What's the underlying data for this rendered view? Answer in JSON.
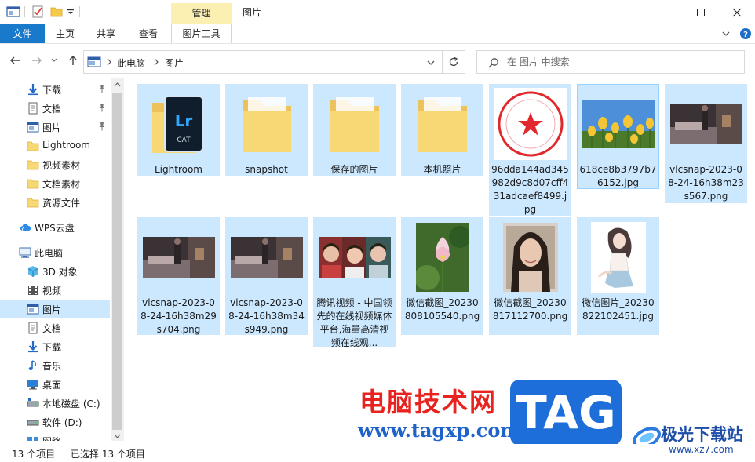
{
  "window": {
    "title": "图片",
    "context_tab": "管理"
  },
  "ribbon": {
    "file": "文件",
    "home": "主页",
    "share": "共享",
    "view": "查看",
    "picture_tools": "图片工具"
  },
  "address": {
    "crumb1": "此电脑",
    "crumb2": "图片"
  },
  "search": {
    "placeholder": "在 图片 中搜索"
  },
  "sidebar": {
    "items": [
      {
        "label": "下载",
        "icon": "download-arrow-icon",
        "pinned": true
      },
      {
        "label": "文档",
        "icon": "document-icon",
        "pinned": true
      },
      {
        "label": "图片",
        "icon": "pictures-icon",
        "pinned": true
      },
      {
        "label": "Lightroom",
        "icon": "folder-icon"
      },
      {
        "label": "视频素材",
        "icon": "folder-icon"
      },
      {
        "label": "文档素材",
        "icon": "folder-icon"
      },
      {
        "label": "资源文件",
        "icon": "folder-icon"
      },
      {
        "label": "WPS云盘",
        "icon": "cloud-icon"
      },
      {
        "label": "此电脑",
        "icon": "computer-icon"
      },
      {
        "label": "3D 对象",
        "icon": "3d-objects-icon"
      },
      {
        "label": "视频",
        "icon": "video-icon"
      },
      {
        "label": "图片",
        "icon": "pictures-icon",
        "selected": true
      },
      {
        "label": "文档",
        "icon": "document-icon"
      },
      {
        "label": "下载",
        "icon": "download-arrow-icon"
      },
      {
        "label": "音乐",
        "icon": "music-note-icon"
      },
      {
        "label": "桌面",
        "icon": "desktop-icon"
      },
      {
        "label": "本地磁盘 (C:)",
        "icon": "drive-c-icon"
      },
      {
        "label": "软件 (D:)",
        "icon": "drive-d-icon"
      },
      {
        "label": "网络",
        "icon": "network-icon"
      }
    ]
  },
  "files": [
    {
      "name": "Lightroom",
      "kind": "folder-lr"
    },
    {
      "name": "snapshot",
      "kind": "folder"
    },
    {
      "name": "保存的图片",
      "kind": "folder"
    },
    {
      "name": "本机照片",
      "kind": "folder"
    },
    {
      "name": "96dda144ad345982d9c8d07cff431adcaef8499.jpg",
      "kind": "seal"
    },
    {
      "name": "618ce8b3797b76152.jpg",
      "kind": "tulips"
    },
    {
      "name": "vlcsnap-2023-08-24-16h38m23s567.png",
      "kind": "bedroom"
    },
    {
      "name": "vlcsnap-2023-08-24-16h38m29s704.png",
      "kind": "bedroom"
    },
    {
      "name": "vlcsnap-2023-08-24-16h38m34s949.png",
      "kind": "bedroom"
    },
    {
      "name": "腾讯视频 - 中国领先的在线视频媒体平台,海量高清视频在线观...",
      "kind": "people"
    },
    {
      "name": "微信截图_20230808105540.png",
      "kind": "lotus"
    },
    {
      "name": "微信截图_20230817112700.png",
      "kind": "portrait"
    },
    {
      "name": "微信图片_20230822102451.jpg",
      "kind": "drawing"
    }
  ],
  "status": {
    "count": "13 个项目",
    "selected": "已选择 13 个项目"
  },
  "watermark": {
    "cn": "电脑技术网",
    "url": "www.tagxp.com",
    "tag": "TAG",
    "site2": "极光下载站",
    "site2_url": "www.xz7.com"
  },
  "colors": {
    "file_tab": "#1979ca",
    "selection": "#cce8ff",
    "context_tab": "#fbf0b2"
  }
}
